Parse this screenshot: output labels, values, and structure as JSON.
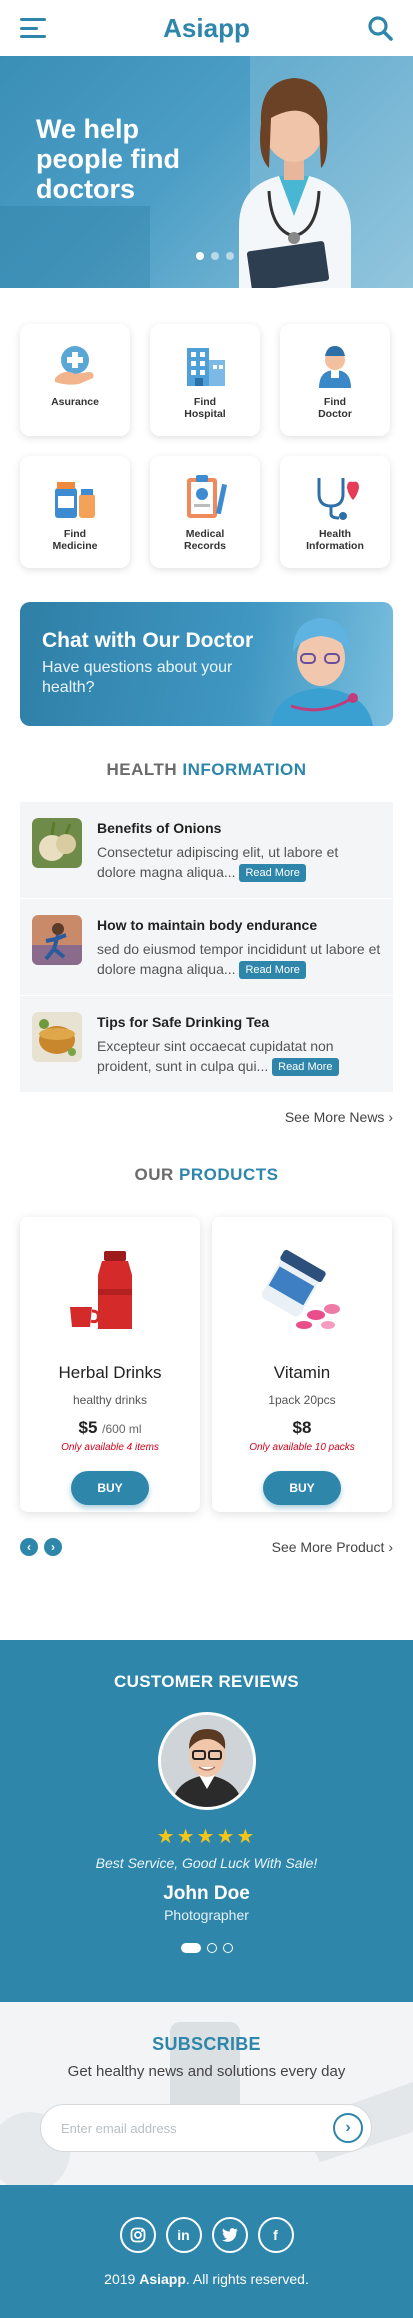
{
  "header": {
    "brand": "Asiapp"
  },
  "hero": {
    "headline": "We help people find doctors",
    "slides_total": 3,
    "slide_active": 1
  },
  "services": [
    {
      "label": "Asurance",
      "icon": "insurance-hand-icon"
    },
    {
      "label": "Find\nHospital",
      "icon": "hospital-building-icon"
    },
    {
      "label": "Find\nDoctor",
      "icon": "doctor-icon"
    },
    {
      "label": "Find\nMedicine",
      "icon": "medicine-bottles-icon"
    },
    {
      "label": "Medical\nRecords",
      "icon": "clipboard-records-icon"
    },
    {
      "label": "Health\nInformation",
      "icon": "stethoscope-heart-icon"
    }
  ],
  "chat": {
    "title": "Chat with Our Doctor",
    "subtitle": "Have questions about your health?"
  },
  "health": {
    "title_a": "HEALTH",
    "title_b": "INFORMATION",
    "items": [
      {
        "title": "Benefits of Onions",
        "text": "Consectetur adipiscing elit, ut labore et dolore magna aliqua...",
        "read_more": "Read More"
      },
      {
        "title": "How to maintain body endurance",
        "text": "sed do eiusmod tempor incididunt ut labore et dolore magna aliqua...",
        "read_more": "Read More"
      },
      {
        "title": "Tips for Safe Drinking Tea",
        "text": "Excepteur sint occaecat cupidatat non proident, sunt in culpa qui...",
        "read_more": "Read More"
      }
    ],
    "see_more": "See More News ›"
  },
  "products": {
    "title_a": "OUR",
    "title_b": "PRODUCTS",
    "items": [
      {
        "name": "Herbal Drinks",
        "desc": "healthy drinks",
        "price": "$5",
        "unit": "/600 ml",
        "availability": "Only available 4 items",
        "buy": "BUY"
      },
      {
        "name": "Vitamin",
        "desc": "1pack 20pcs",
        "price": "$8",
        "unit": "",
        "availability": "Only available 10 packs",
        "buy": "BUY"
      }
    ],
    "see_more": "See More Product ›"
  },
  "reviews": {
    "title": "CUSTOMER REVIEWS",
    "rating": 5,
    "stars": "★★★★★",
    "quote": "Best Service, Good Luck With Sale!",
    "name": "John Doe",
    "role": "Photographer"
  },
  "subscribe": {
    "title": "SUBSCRIBE",
    "text": "Get healthy news and solutions every day",
    "placeholder": "Enter email address"
  },
  "footer": {
    "socials": [
      "instagram-icon",
      "linkedin-icon",
      "twitter-icon",
      "facebook-icon"
    ],
    "year": "2019",
    "brand": "Asiapp",
    "rights": ". All rights reserved."
  },
  "colors": {
    "primary": "#2e86ab",
    "alert": "#d0021b",
    "star": "#f5c518"
  }
}
